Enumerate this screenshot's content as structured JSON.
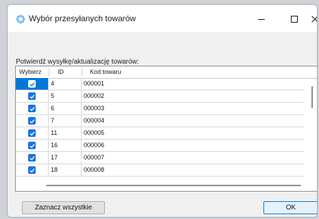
{
  "window": {
    "title": "Wybór przesyłanych towarów",
    "controls": {
      "minimize": "–",
      "maximize": "☐",
      "close": "✕"
    }
  },
  "prompt": "Potwierdź wysyłkę/aktualizację towarów:",
  "table": {
    "headers": {
      "select": "Wybierz",
      "id": "ID",
      "kod": "Kod towaru"
    },
    "rows": [
      {
        "id": "4",
        "kod": "000001",
        "checked": true,
        "selected": true
      },
      {
        "id": "5",
        "kod": "000002",
        "checked": true
      },
      {
        "id": "6",
        "kod": "000003",
        "checked": true
      },
      {
        "id": "7",
        "kod": "000004",
        "checked": true
      },
      {
        "id": "11",
        "kod": "000005",
        "checked": true
      },
      {
        "id": "16",
        "kod": "000006",
        "checked": true
      },
      {
        "id": "17",
        "kod": "000007",
        "checked": true
      },
      {
        "id": "18",
        "kod": "000008",
        "checked": true
      }
    ]
  },
  "buttons": {
    "select_all": "Zaznacz wszystkie",
    "ok": "OK"
  },
  "colors": {
    "checkbox": "#1a73e8",
    "selection": "#0078d7"
  },
  "icons": {
    "app": "gear-flower-icon"
  }
}
